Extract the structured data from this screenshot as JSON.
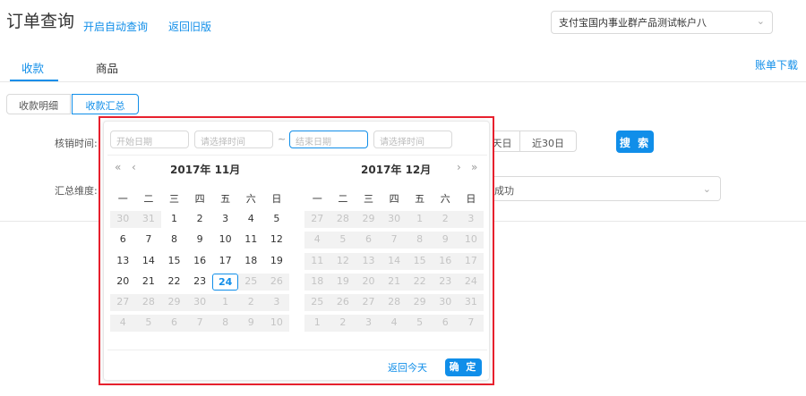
{
  "header": {
    "title": "订单查询",
    "auto_query_link": "开启自动查询",
    "old_version_link": "返回旧版",
    "account_select": "支付宝国内事业群产品测试帐户八"
  },
  "tabs": [
    {
      "label": "收款",
      "active": true
    },
    {
      "label": "商品",
      "active": false
    }
  ],
  "bill_download": "账单下载",
  "segments": {
    "left": "收款明细",
    "right": "收款汇总"
  },
  "filters": {
    "verify_time_label": "核销时间:",
    "quick_day_partial": "天日",
    "quick_30": "近30日",
    "search_button": "搜 索",
    "summary_dim_label": "汇总维度:",
    "summary_dim_value": "成功"
  },
  "picker": {
    "start_date_placeholder": "开始日期",
    "start_time_placeholder": "请选择时间",
    "separator": "~",
    "end_date_placeholder": "结束日期",
    "end_time_placeholder": "请选择时间",
    "nav": {
      "prev_year": "«",
      "prev_month": "‹",
      "next_month": "›",
      "next_year": "»"
    },
    "left_month": "2017年 11月",
    "right_month": "2017年 12月",
    "weekdays": [
      "一",
      "二",
      "三",
      "四",
      "五",
      "六",
      "日"
    ],
    "left_days": [
      [
        "30",
        "31",
        "1",
        "2",
        "3",
        "4",
        "5"
      ],
      [
        "6",
        "7",
        "8",
        "9",
        "10",
        "11",
        "12"
      ],
      [
        "13",
        "14",
        "15",
        "16",
        "17",
        "18",
        "19"
      ],
      [
        "20",
        "21",
        "22",
        "23",
        "24",
        "25",
        "26"
      ],
      [
        "27",
        "28",
        "29",
        "30",
        "1",
        "2",
        "3"
      ],
      [
        "4",
        "5",
        "6",
        "7",
        "8",
        "9",
        "10"
      ]
    ],
    "right_days": [
      [
        "27",
        "28",
        "29",
        "30",
        "1",
        "2",
        "3"
      ],
      [
        "4",
        "5",
        "6",
        "7",
        "8",
        "9",
        "10"
      ],
      [
        "11",
        "12",
        "13",
        "14",
        "15",
        "16",
        "17"
      ],
      [
        "18",
        "19",
        "20",
        "21",
        "22",
        "23",
        "24"
      ],
      [
        "25",
        "26",
        "27",
        "28",
        "29",
        "30",
        "31"
      ],
      [
        "1",
        "2",
        "3",
        "4",
        "5",
        "6",
        "7"
      ]
    ],
    "today": "24",
    "back_today": "返回今天",
    "ok_button": "确 定"
  },
  "colors": {
    "accent": "#108ee9",
    "highlight_border": "#e8212e",
    "disabled_bg": "#f2f2f2"
  },
  "icons": {
    "dropdown": "chevron-down-icon"
  }
}
